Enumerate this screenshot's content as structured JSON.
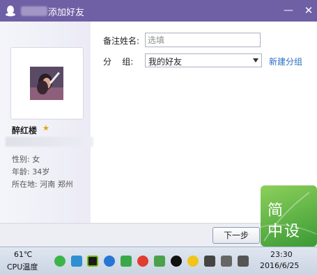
{
  "window": {
    "title": "添加好友",
    "minimize_glyph": "—",
    "close_glyph": "✕"
  },
  "profile": {
    "nickname": "醉红楼",
    "gender": "性别: 女",
    "age": "年龄: 34岁",
    "location": "所在地: 河南  郑州"
  },
  "form": {
    "remark_label": "备注姓名:",
    "remark_placeholder": "选填",
    "remark_value": "",
    "group_label": "分    组:",
    "group_value": "我的好友",
    "new_group_link": "新建分组"
  },
  "footer": {
    "next_button": "下一步"
  },
  "watermark": {
    "line1": "简",
    "line2": "中设"
  },
  "taskbar": {
    "cpu_temp": "61℃",
    "cpu_label": "CPU温度",
    "time": "23:30",
    "date": "2016/6/25"
  },
  "colors": {
    "titlebar": "#6f5fa5",
    "link": "#2a6dc6",
    "star": "#e1a300"
  },
  "tray_icons": [
    "wechat-icon",
    "security-icon",
    "nvidia-icon",
    "browser-icon",
    "update-icon",
    "antivirus-icon",
    "shield-icon",
    "qq-icon",
    "game-icon",
    "network-icon",
    "volume-icon",
    "notes-icon"
  ]
}
